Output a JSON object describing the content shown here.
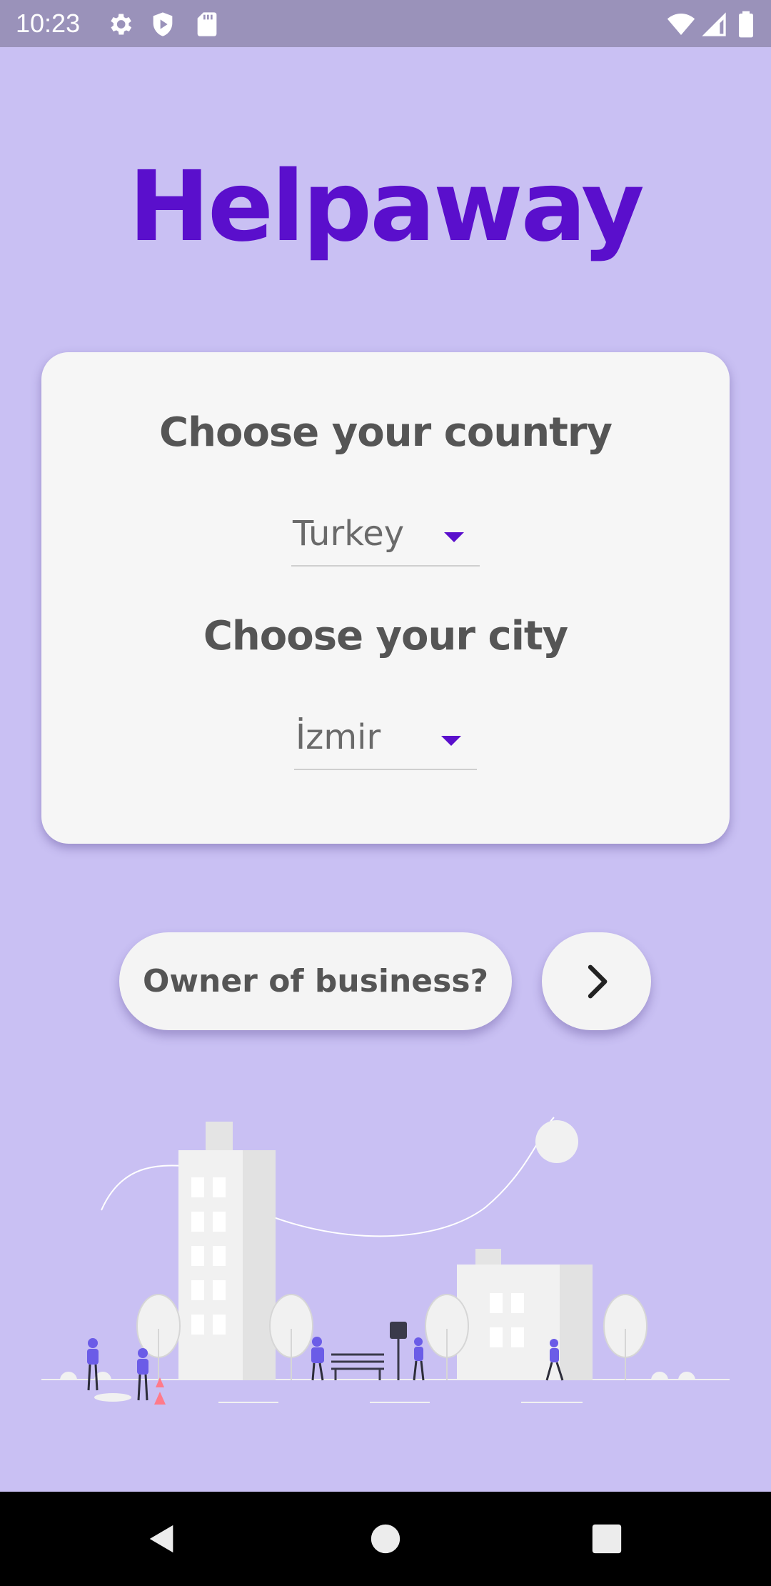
{
  "status_bar": {
    "time": "10:23",
    "icons": [
      "gear-icon",
      "shield-icon",
      "sd-card-icon",
      "wifi-icon",
      "signal-icon",
      "battery-icon"
    ]
  },
  "app": {
    "title": "Helpaway",
    "brand_color": "#5a0fcc",
    "background_color": "#c9c0f3"
  },
  "country_section": {
    "heading": "Choose your country",
    "selected": "Turkey"
  },
  "city_section": {
    "heading": "Choose your city",
    "selected": "İzmir"
  },
  "actions": {
    "owner_label": "Owner of business?",
    "next_icon": "chevron-right-icon"
  },
  "nav_bar": {
    "icons": [
      "back-icon",
      "home-icon",
      "recents-icon"
    ]
  }
}
